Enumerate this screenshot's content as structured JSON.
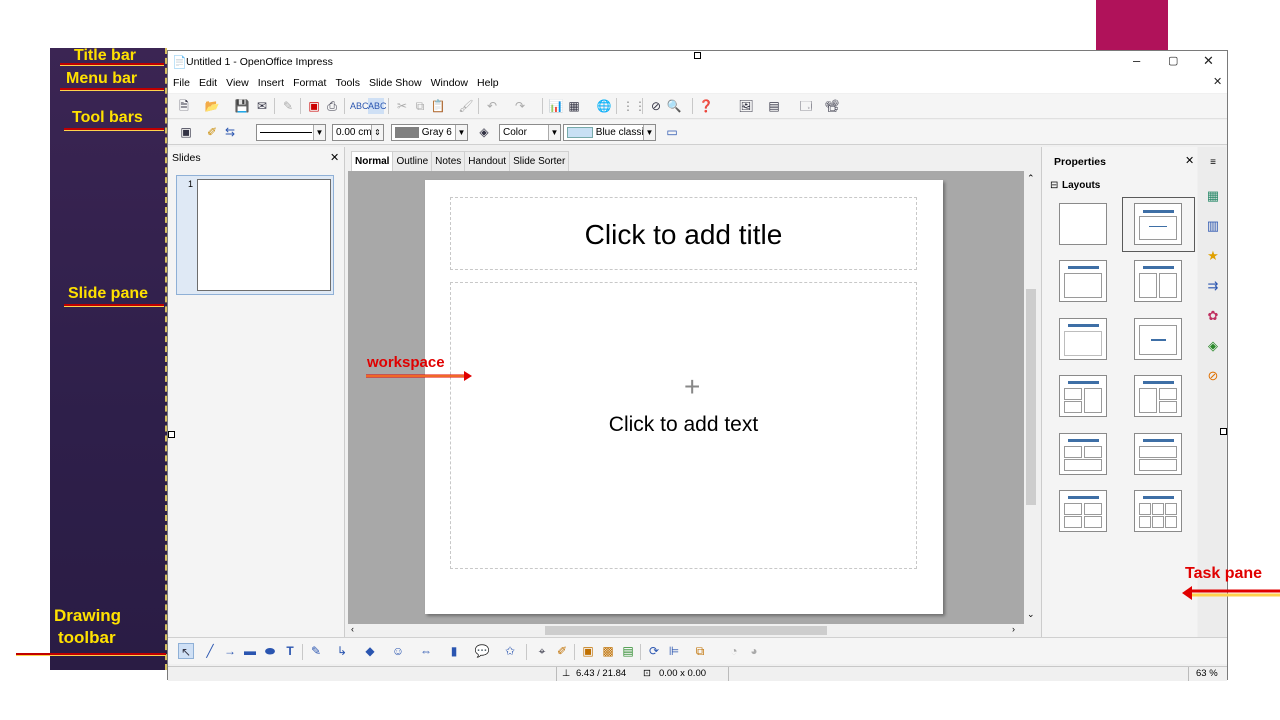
{
  "annotations": {
    "title_bar": "Title bar",
    "menu_bar": "Menu bar",
    "tool_bars": "Tool bars",
    "slide_pane": "Slide pane",
    "workspace": "workspace",
    "drawing_toolbar_1": "Drawing",
    "drawing_toolbar_2": "toolbar",
    "task_pane": "Task pane"
  },
  "window": {
    "title": "Untitled 1 - OpenOffice Impress",
    "minimize": "–",
    "restore": "▢",
    "close": "✕",
    "doc_close": "✕"
  },
  "menu": [
    "File",
    "Edit",
    "View",
    "Insert",
    "Format",
    "Tools",
    "Slide Show",
    "Window",
    "Help"
  ],
  "toolbar2": {
    "line_width": "0.00 cm",
    "line_color": "Gray 6",
    "area_style": "Color",
    "area_fill": "Blue classic"
  },
  "slides_pane": {
    "title": "Slides",
    "close": "✕",
    "slide_number": "1"
  },
  "view_tabs": [
    "Normal",
    "Outline",
    "Notes",
    "Handout",
    "Slide Sorter"
  ],
  "slide": {
    "title_placeholder": "Click to add title",
    "text_placeholder": "Click to add text"
  },
  "properties": {
    "title": "Properties",
    "close": "✕",
    "section": "Layouts",
    "collapse": "⊟"
  },
  "status": {
    "position": "6.43 / 21.84",
    "size": "0.00 x 0.00",
    "zoom": "63 %"
  },
  "colors": {
    "annotation_text": "#ffe100",
    "annotation_red": "#e00000",
    "strip_bg": "#3b2553",
    "accent": "#b0125a"
  }
}
